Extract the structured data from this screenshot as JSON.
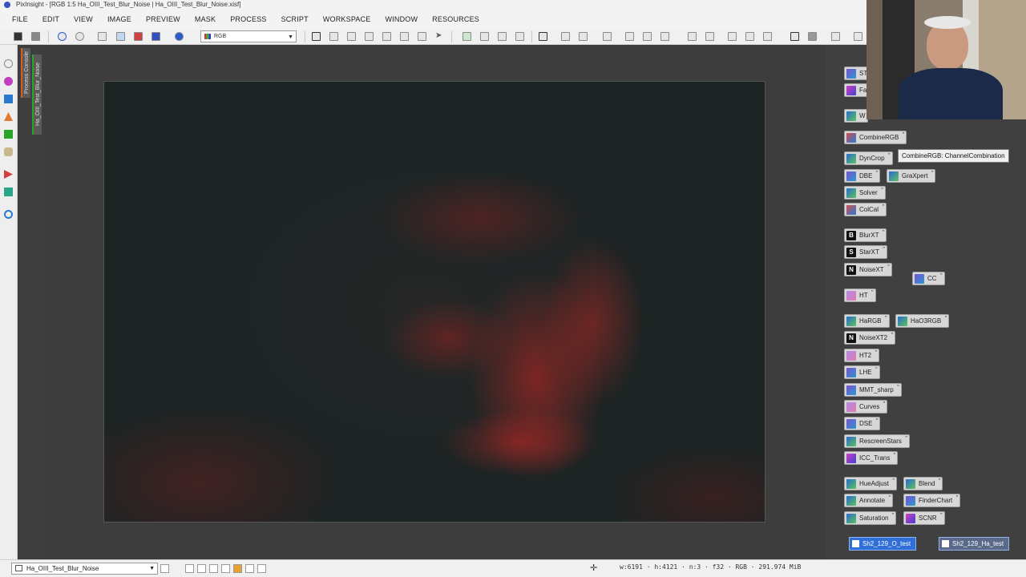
{
  "window": {
    "title": "PixInsight - [RGB 1:5 Ha_OIII_Test_Blur_Noise | Ha_OIII_Test_Blur_Noise.xisf]"
  },
  "menu": [
    "FILE",
    "EDIT",
    "VIEW",
    "IMAGE",
    "PREVIEW",
    "MASK",
    "PROCESS",
    "SCRIPT",
    "WORKSPACE",
    "WINDOW",
    "RESOURCES"
  ],
  "toolbar": {
    "color_mode": "RGB"
  },
  "side_tabs": {
    "process_console": "Process Console",
    "view_tab": "Ha_OIII_Test_Blur_Noise"
  },
  "image_view": {
    "description": "Ha_OIII narrowband nebula image"
  },
  "process_icons": [
    {
      "label": "ST",
      "icon": "process-icon"
    },
    {
      "label": "Fa",
      "icon": "process-icon"
    },
    {
      "label": "W",
      "icon": "process-icon"
    },
    {
      "label": "CombineRGB",
      "icon": "combinergb-icon"
    },
    {
      "label": "DynCrop",
      "icon": "dyncrop-icon"
    },
    {
      "label": "DBE",
      "icon": "dbe-icon"
    },
    {
      "label": "GraXpert",
      "icon": "graxpert-icon"
    },
    {
      "label": "Solver",
      "icon": "solver-icon"
    },
    {
      "label": "ColCal",
      "icon": "colcal-icon"
    },
    {
      "label": "BlurXT",
      "icon": "B"
    },
    {
      "label": "StarXT",
      "icon": "S"
    },
    {
      "label": "NoiseXT",
      "icon": "N"
    },
    {
      "label": "CC",
      "icon": "cc-icon"
    },
    {
      "label": "HT",
      "icon": "ht-icon"
    },
    {
      "label": "HaRGB",
      "icon": "hargb-icon"
    },
    {
      "label": "HaO3RGB",
      "icon": "hao3rgb-icon"
    },
    {
      "label": "NoiseXT2",
      "icon": "N"
    },
    {
      "label": "HT2",
      "icon": "ht2-icon"
    },
    {
      "label": "LHE",
      "icon": "lhe-icon"
    },
    {
      "label": "MMT_sharp",
      "icon": "mmt-icon"
    },
    {
      "label": "Curves",
      "icon": "curves-icon"
    },
    {
      "label": "DSE",
      "icon": "dse-icon"
    },
    {
      "label": "RescreenStars",
      "icon": "rescreenstars-icon"
    },
    {
      "label": "ICC_Trans",
      "icon": "icc-icon"
    },
    {
      "label": "HueAdjust",
      "icon": "hueadjust-icon"
    },
    {
      "label": "Blend",
      "icon": "blend-icon"
    },
    {
      "label": "Annotate",
      "icon": "annotate-icon"
    },
    {
      "label": "FinderChart",
      "icon": "finderchart-icon"
    },
    {
      "label": "Saturation",
      "icon": "saturation-icon"
    },
    {
      "label": "SCNR",
      "icon": "scnr-icon"
    }
  ],
  "tooltip": "CombineRGB: ChannelCombination",
  "image_icons": [
    {
      "label": "Sh2_129_O_test"
    },
    {
      "label": "Sh2_129_Ha_test"
    }
  ],
  "statusbar": {
    "view": "Ha_OIII_Test_Blur_Noise",
    "stats": "w:6191 · h:4121 · n:3 · f32 · RGB · 291.974 MiB"
  }
}
